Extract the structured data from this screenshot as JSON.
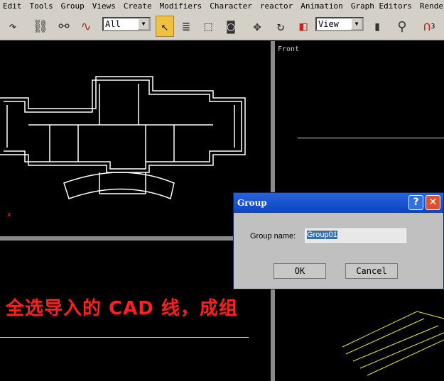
{
  "menu": [
    "Edit",
    "Tools",
    "Group",
    "Views",
    "Create",
    "Modifiers",
    "Character",
    "reactor",
    "Animation",
    "Graph Editors",
    "Rendering"
  ],
  "toolbar": {
    "selection_filter": "All",
    "coord_system": "View",
    "snap_count": "3"
  },
  "viewports": {
    "front_label": "Front"
  },
  "caption": "全选导入的 CAD 线，成组",
  "dialog": {
    "title": "Group",
    "help": "?",
    "close": "✕",
    "name_label": "Group name:",
    "name_value": "Group01",
    "ok": "OK",
    "cancel": "Cancel"
  },
  "colors": {
    "caption": "#ff2020",
    "titlebar": "#0a47c4",
    "active_tool": "#f0c040"
  }
}
